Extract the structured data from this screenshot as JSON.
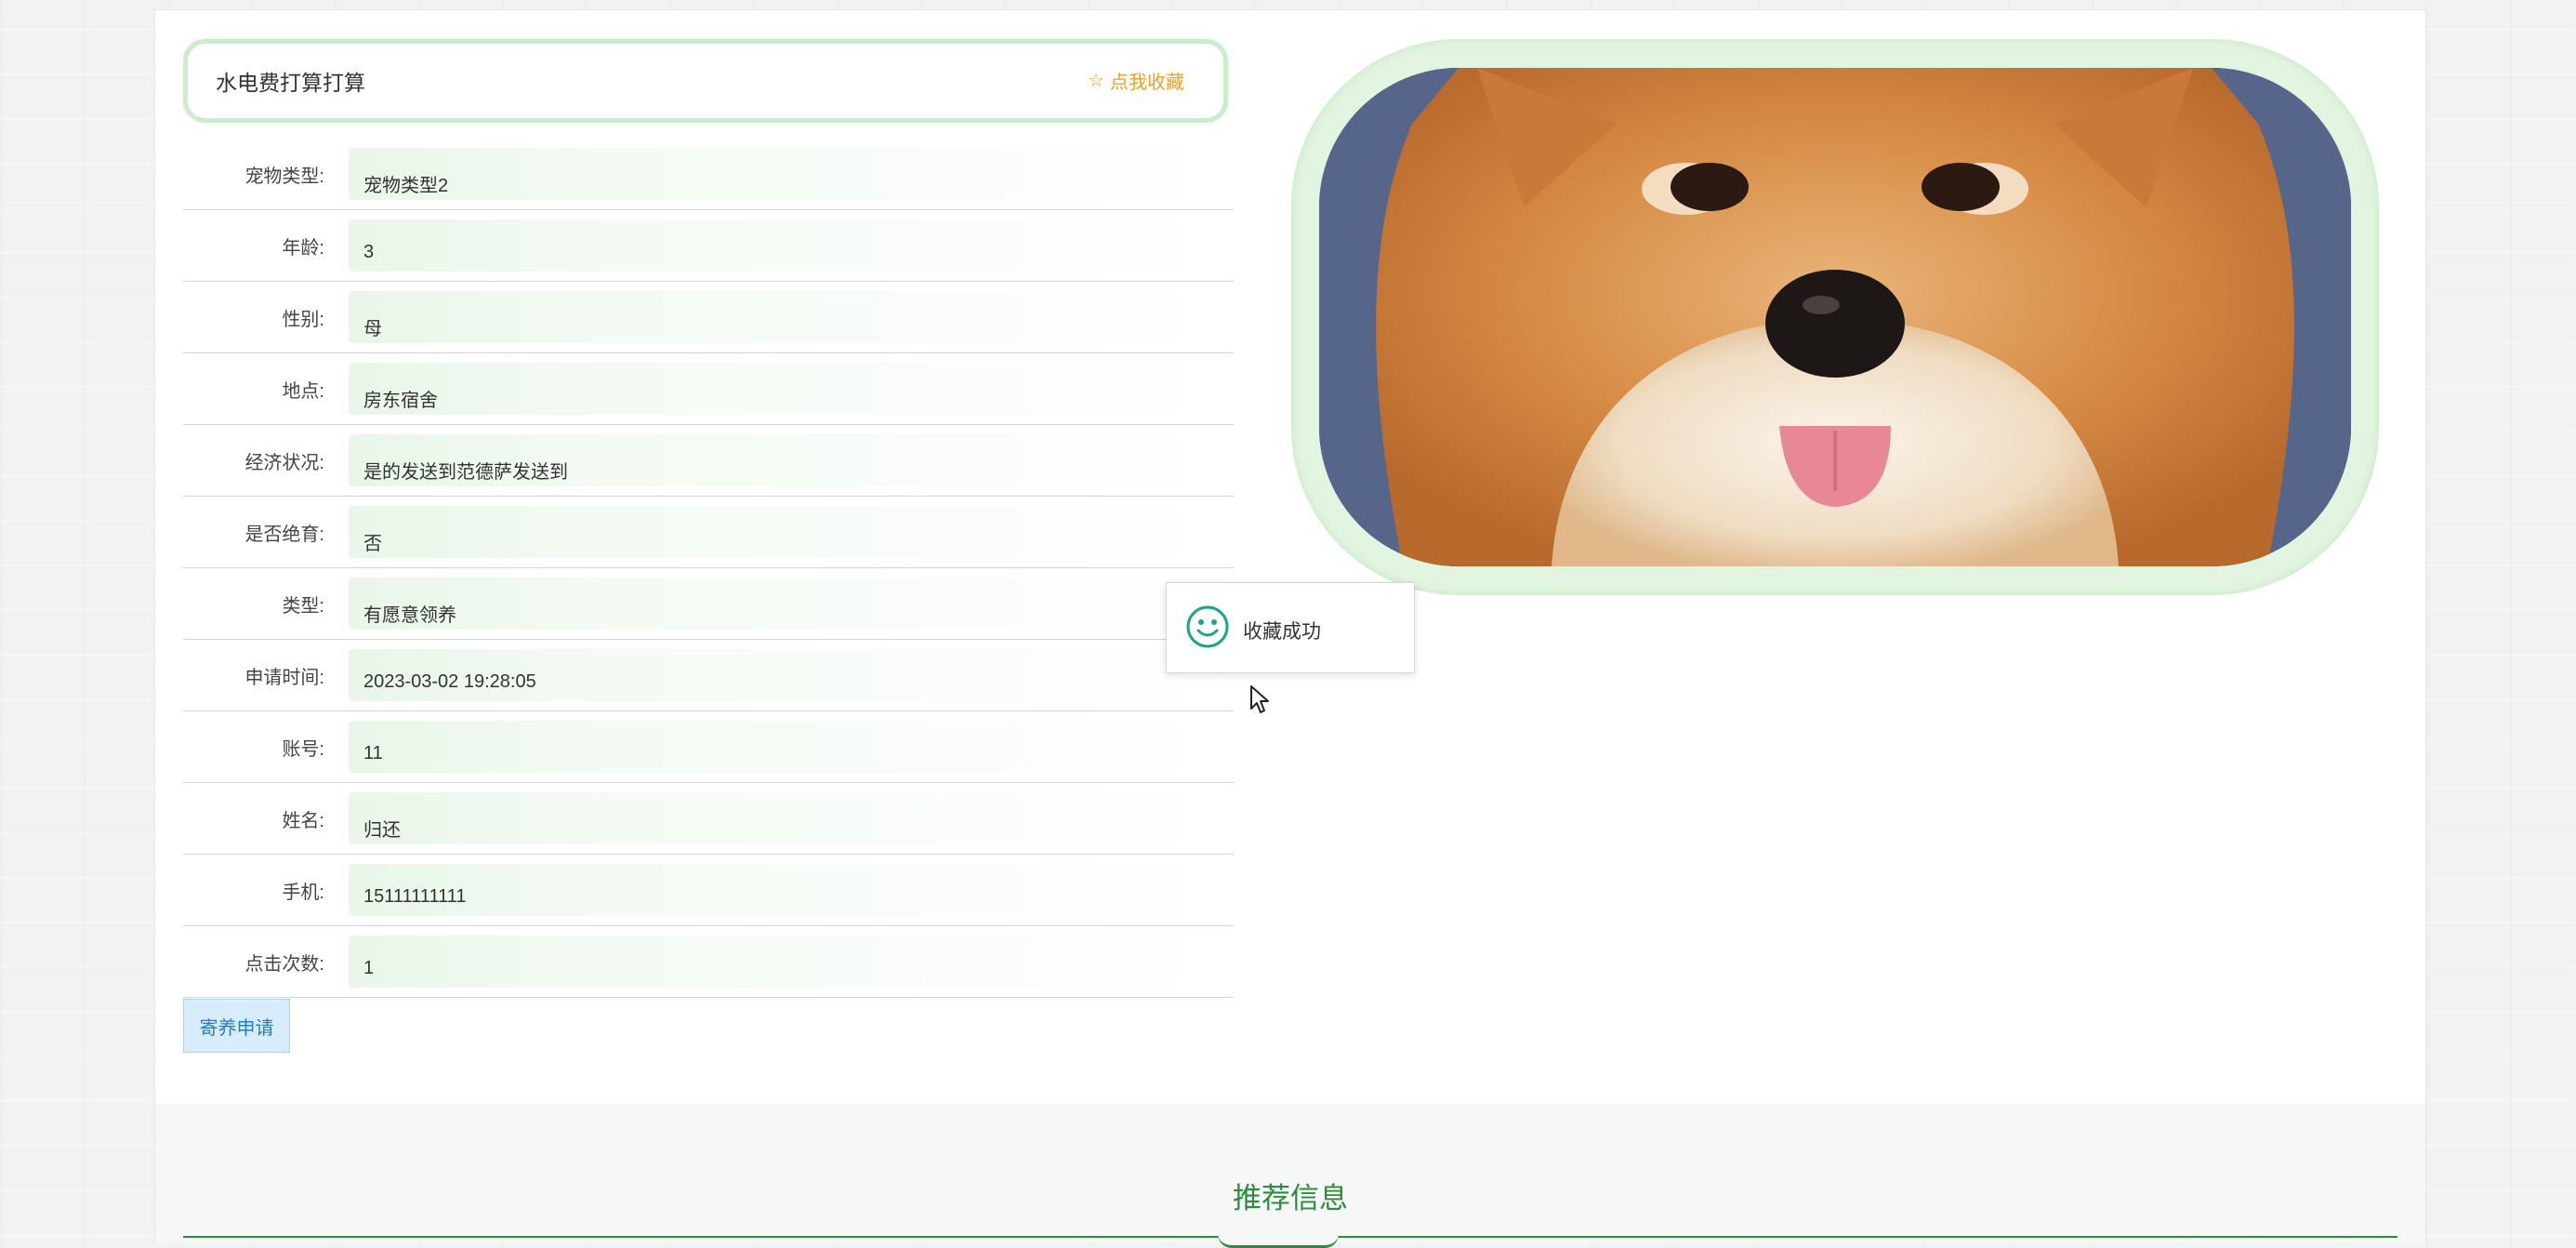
{
  "header": {
    "title": "水电费打算打算",
    "favorite_icon": "star-outline-icon",
    "favorite_label": "点我收藏",
    "accent_color": "#f0a020"
  },
  "details": [
    {
      "label": "宠物类型:",
      "value": "宠物类型2"
    },
    {
      "label": "年龄:",
      "value": "3"
    },
    {
      "label": "性别:",
      "value": "母"
    },
    {
      "label": "地点:",
      "value": "房东宿舍"
    },
    {
      "label": "经济状况:",
      "value": "是的发送到范德萨发送到"
    },
    {
      "label": "是否绝育:",
      "value": "否"
    },
    {
      "label": "类型:",
      "value": "有愿意领养"
    },
    {
      "label": "申请时间:",
      "value": "2023-03-02 19:28:05"
    },
    {
      "label": "账号:",
      "value": "11"
    },
    {
      "label": "姓名:",
      "value": "归还"
    },
    {
      "label": "手机:",
      "value": "15111111111"
    },
    {
      "label": "点击次数:",
      "value": "1"
    }
  ],
  "actions": {
    "apply_label": "寄养申请"
  },
  "toast": {
    "icon": "smile-icon",
    "message": "收藏成功"
  },
  "recommend": {
    "title": "推荐信息",
    "color": "#2e8b3c"
  }
}
